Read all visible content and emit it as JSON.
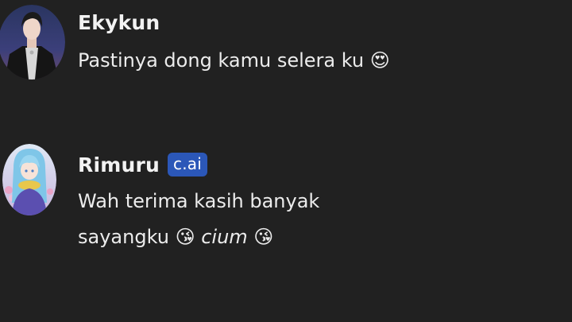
{
  "messages": [
    {
      "author": "Ekykun",
      "avatar_icon": "user-avatar-dark-portrait",
      "lines": [
        "Pastinya dong kamu selera ku 😍"
      ]
    },
    {
      "author": "Rimuru",
      "badge": "c.ai",
      "avatar_icon": "bot-avatar-blue-hair-portrait",
      "lines": [
        "Wah terima kasih banyak"
      ],
      "line2_before": "sayangku 😘 ",
      "line2_italic": "cium",
      "line2_after": " 😘"
    }
  ],
  "colors": {
    "background": "#212121",
    "badge": "#2b57b8",
    "text": "#ececec"
  }
}
